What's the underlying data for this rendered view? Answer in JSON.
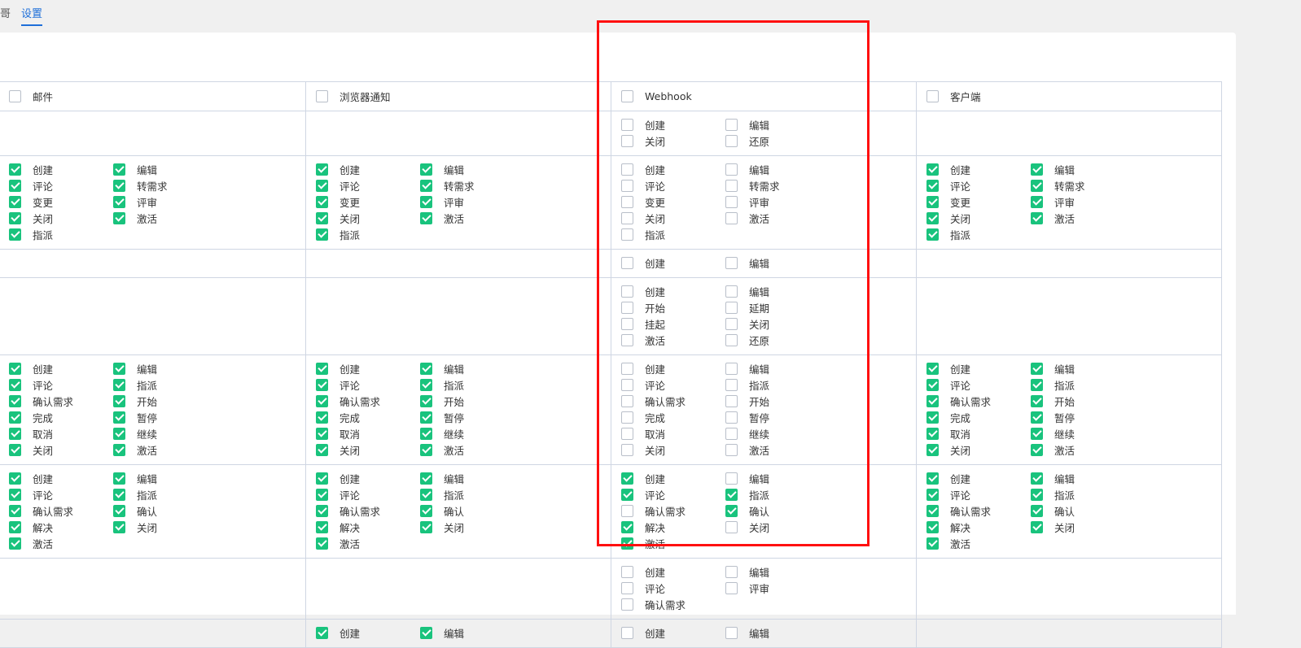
{
  "tabs": {
    "prev_fragment": "哥",
    "active": "设置"
  },
  "columns": [
    "邮件",
    "浏览器通知",
    "Webhook",
    "客户端"
  ],
  "rows": [
    {
      "height": 0,
      "cells": [
        [],
        [],
        [
          [
            "创建",
            0
          ],
          [
            "编辑",
            0
          ],
          [
            "关闭",
            0
          ],
          [
            "还原",
            0
          ]
        ],
        []
      ]
    },
    {
      "cells": [
        [
          [
            "创建",
            1
          ],
          [
            "编辑",
            1
          ],
          [
            "评论",
            1
          ],
          [
            "转需求",
            1
          ],
          [
            "变更",
            1
          ],
          [
            "评审",
            1
          ],
          [
            "关闭",
            1
          ],
          [
            "激活",
            1
          ],
          [
            "指派",
            1
          ]
        ],
        [
          [
            "创建",
            1
          ],
          [
            "编辑",
            1
          ],
          [
            "评论",
            1
          ],
          [
            "转需求",
            1
          ],
          [
            "变更",
            1
          ],
          [
            "评审",
            1
          ],
          [
            "关闭",
            1
          ],
          [
            "激活",
            1
          ],
          [
            "指派",
            1
          ]
        ],
        [
          [
            "创建",
            0
          ],
          [
            "编辑",
            0
          ],
          [
            "评论",
            0
          ],
          [
            "转需求",
            0
          ],
          [
            "变更",
            0
          ],
          [
            "评审",
            0
          ],
          [
            "关闭",
            0
          ],
          [
            "激活",
            0
          ],
          [
            "指派",
            0
          ]
        ],
        [
          [
            "创建",
            1
          ],
          [
            "编辑",
            1
          ],
          [
            "评论",
            1
          ],
          [
            "转需求",
            1
          ],
          [
            "变更",
            1
          ],
          [
            "评审",
            1
          ],
          [
            "关闭",
            1
          ],
          [
            "激活",
            1
          ],
          [
            "指派",
            1
          ]
        ]
      ]
    },
    {
      "cells": [
        [],
        [],
        [
          [
            "创建",
            0
          ],
          [
            "编辑",
            0
          ]
        ],
        []
      ]
    },
    {
      "cells": [
        [],
        [],
        [
          [
            "创建",
            0
          ],
          [
            "编辑",
            0
          ],
          [
            "开始",
            0
          ],
          [
            "延期",
            0
          ],
          [
            "挂起",
            0
          ],
          [
            "关闭",
            0
          ],
          [
            "激活",
            0
          ],
          [
            "还原",
            0
          ]
        ],
        []
      ]
    },
    {
      "cells": [
        [
          [
            "创建",
            1
          ],
          [
            "编辑",
            1
          ],
          [
            "评论",
            1
          ],
          [
            "指派",
            1
          ],
          [
            "确认需求",
            1
          ],
          [
            "开始",
            1
          ],
          [
            "完成",
            1
          ],
          [
            "暂停",
            1
          ],
          [
            "取消",
            1
          ],
          [
            "继续",
            1
          ],
          [
            "关闭",
            1
          ],
          [
            "激活",
            1
          ]
        ],
        [
          [
            "创建",
            1
          ],
          [
            "编辑",
            1
          ],
          [
            "评论",
            1
          ],
          [
            "指派",
            1
          ],
          [
            "确认需求",
            1
          ],
          [
            "开始",
            1
          ],
          [
            "完成",
            1
          ],
          [
            "暂停",
            1
          ],
          [
            "取消",
            1
          ],
          [
            "继续",
            1
          ],
          [
            "关闭",
            1
          ],
          [
            "激活",
            1
          ]
        ],
        [
          [
            "创建",
            0
          ],
          [
            "编辑",
            0
          ],
          [
            "评论",
            0
          ],
          [
            "指派",
            0
          ],
          [
            "确认需求",
            0
          ],
          [
            "开始",
            0
          ],
          [
            "完成",
            0
          ],
          [
            "暂停",
            0
          ],
          [
            "取消",
            0
          ],
          [
            "继续",
            0
          ],
          [
            "关闭",
            0
          ],
          [
            "激活",
            0
          ]
        ],
        [
          [
            "创建",
            1
          ],
          [
            "编辑",
            1
          ],
          [
            "评论",
            1
          ],
          [
            "指派",
            1
          ],
          [
            "确认需求",
            1
          ],
          [
            "开始",
            1
          ],
          [
            "完成",
            1
          ],
          [
            "暂停",
            1
          ],
          [
            "取消",
            1
          ],
          [
            "继续",
            1
          ],
          [
            "关闭",
            1
          ],
          [
            "激活",
            1
          ]
        ]
      ]
    },
    {
      "cells": [
        [
          [
            "创建",
            1
          ],
          [
            "编辑",
            1
          ],
          [
            "评论",
            1
          ],
          [
            "指派",
            1
          ],
          [
            "确认需求",
            1
          ],
          [
            "确认",
            1
          ],
          [
            "解决",
            1
          ],
          [
            "关闭",
            1
          ],
          [
            "激活",
            1
          ]
        ],
        [
          [
            "创建",
            1
          ],
          [
            "编辑",
            1
          ],
          [
            "评论",
            1
          ],
          [
            "指派",
            1
          ],
          [
            "确认需求",
            1
          ],
          [
            "确认",
            1
          ],
          [
            "解决",
            1
          ],
          [
            "关闭",
            1
          ],
          [
            "激活",
            1
          ]
        ],
        [
          [
            "创建",
            1
          ],
          [
            "编辑",
            0
          ],
          [
            "评论",
            1
          ],
          [
            "指派",
            1
          ],
          [
            "确认需求",
            0
          ],
          [
            "确认",
            1
          ],
          [
            "解决",
            1
          ],
          [
            "关闭",
            0
          ],
          [
            "激活",
            1
          ]
        ],
        [
          [
            "创建",
            1
          ],
          [
            "编辑",
            1
          ],
          [
            "评论",
            1
          ],
          [
            "指派",
            1
          ],
          [
            "确认需求",
            1
          ],
          [
            "确认",
            1
          ],
          [
            "解决",
            1
          ],
          [
            "关闭",
            1
          ],
          [
            "激活",
            1
          ]
        ]
      ]
    },
    {
      "cells": [
        [],
        [],
        [
          [
            "创建",
            0
          ],
          [
            "编辑",
            0
          ],
          [
            "评论",
            0
          ],
          [
            "评审",
            0
          ],
          [
            "确认需求",
            0
          ]
        ],
        []
      ]
    },
    {
      "cells": [
        [],
        [
          [
            "创建",
            1
          ],
          [
            "编辑",
            1
          ]
        ],
        [
          [
            "创建",
            0
          ],
          [
            "编辑",
            0
          ]
        ],
        []
      ]
    }
  ]
}
